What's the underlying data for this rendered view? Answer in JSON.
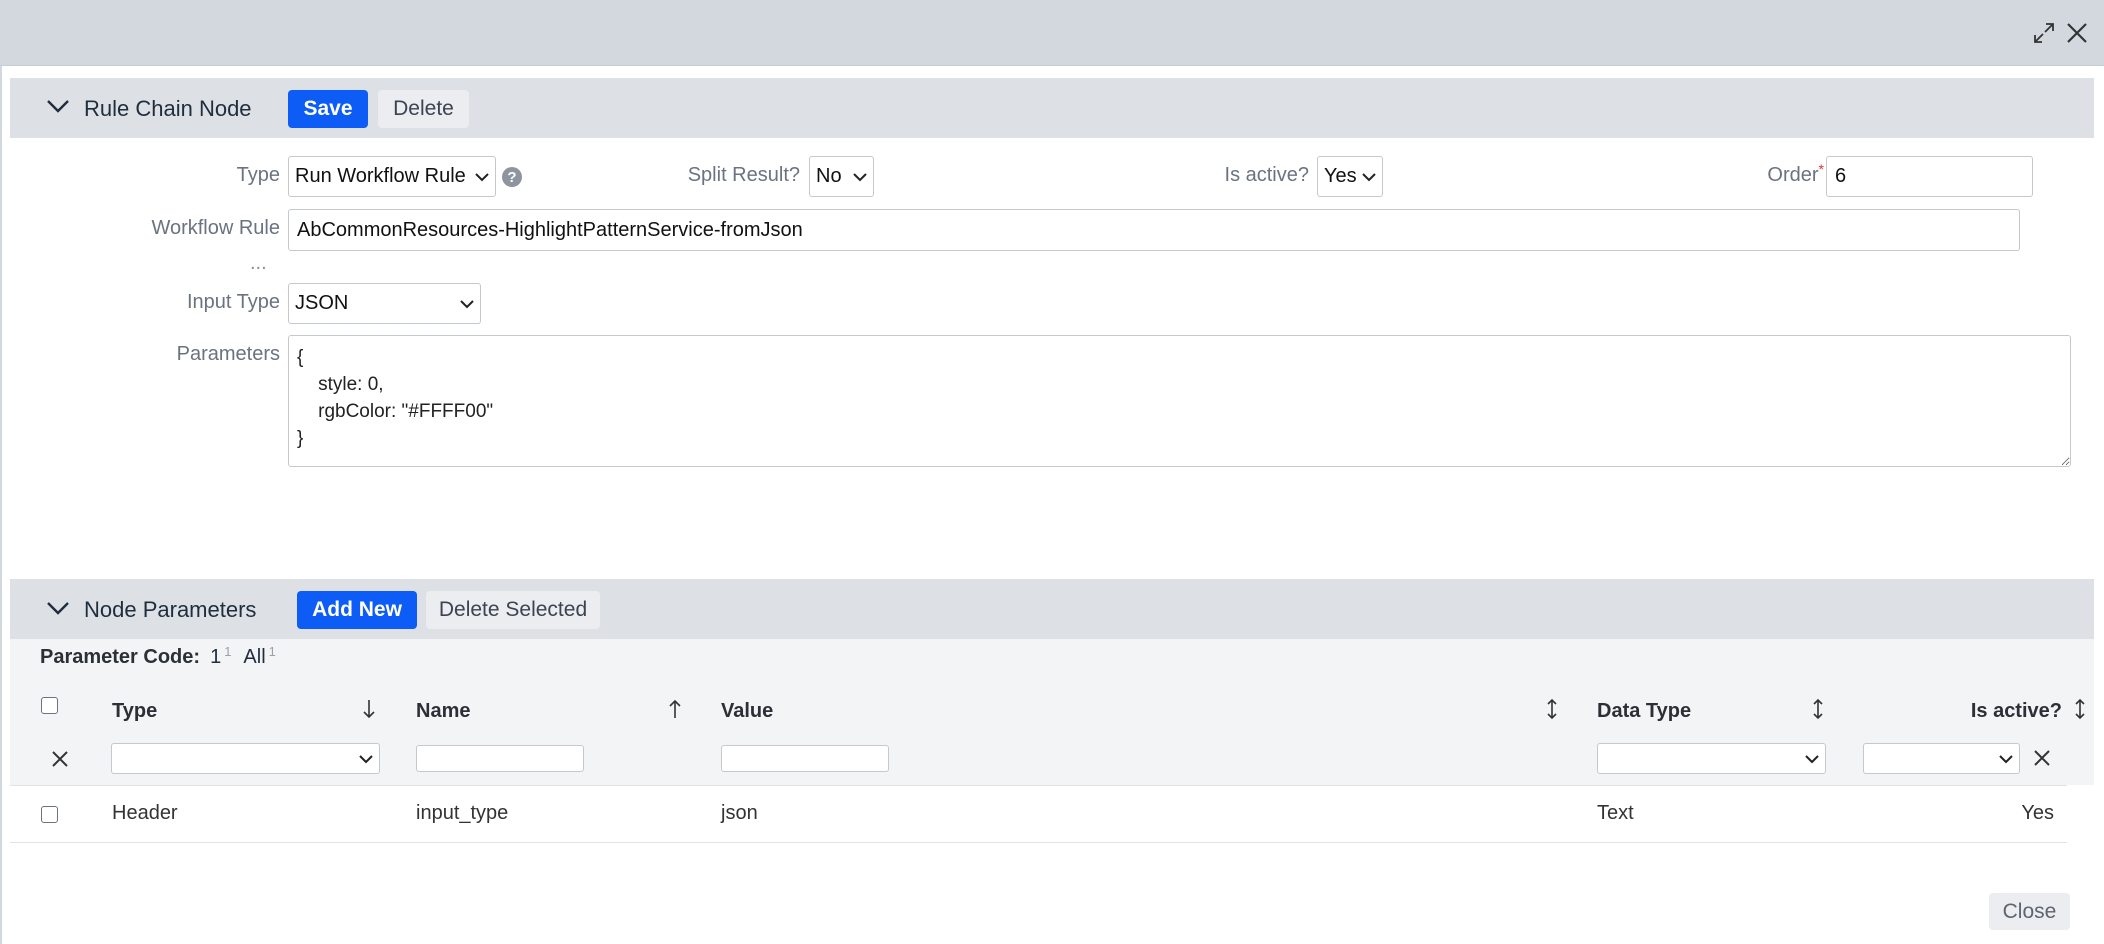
{
  "rule_chain_node": {
    "title": "Rule Chain Node",
    "save_label": "Save",
    "delete_label": "Delete",
    "fields": {
      "type_label": "Type",
      "type_value": "Run Workflow Rule",
      "split_label": "Split Result?",
      "split_value": "No",
      "active_label": "Is active?",
      "active_value": "Yes",
      "order_label": "Order",
      "order_required": "*",
      "order_value": "6",
      "workflow_label": "Workflow Rule",
      "workflow_value": "AbCommonResources-HighlightPatternService-fromJson",
      "more_label": "...",
      "input_type_label": "Input Type",
      "input_type_value": "JSON",
      "parameters_label": "Parameters",
      "parameters_value": "{\n    style: 0,\n    rgbColor: \"#FFFF00\"\n}"
    }
  },
  "node_parameters": {
    "title": "Node Parameters",
    "add_label": "Add New",
    "delete_selected_label": "Delete Selected",
    "group_label": "Parameter Code:",
    "group_value": "1",
    "group_value_count": "1",
    "group_all": "All",
    "group_all_count": "1",
    "columns": {
      "type": "Type",
      "name": "Name",
      "value": "Value",
      "data_type": "Data Type",
      "is_active": "Is active?"
    },
    "rows": [
      {
        "type": "Header",
        "name": "input_type",
        "value": "json",
        "data_type": "Text",
        "is_active": "Yes"
      }
    ]
  },
  "footer": {
    "close_label": "Close"
  },
  "icons": {
    "expand": "expand-icon",
    "close": "close-icon",
    "collapse": "chevron-down-icon",
    "help": "help-icon",
    "sort_desc": "arrow-down-icon",
    "sort_asc": "arrow-up-icon",
    "sortable": "sort-icon",
    "clear_filter": "clear-filter-icon"
  },
  "colors": {
    "primary": "#0d5cf5",
    "header_bg": "#d3d8de",
    "section_bg": "#dde1e6",
    "required": "#e0332d"
  }
}
